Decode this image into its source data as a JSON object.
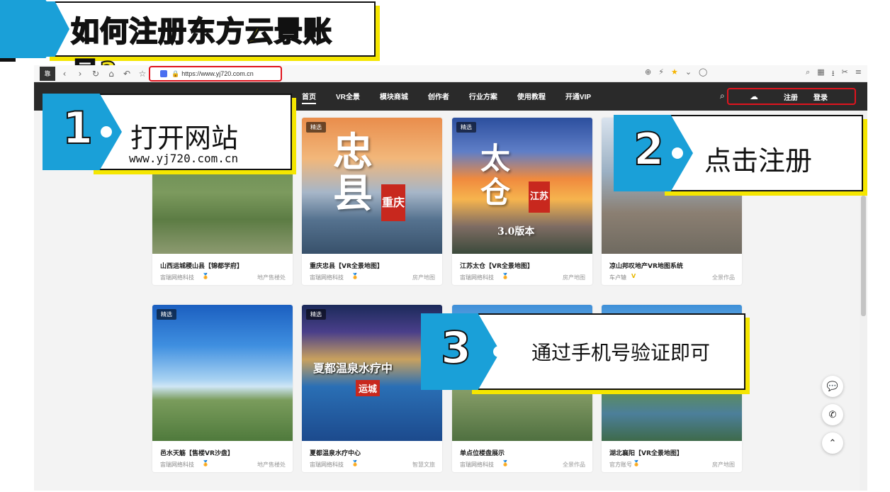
{
  "banner": {
    "title": "如何注册东方云景账号?"
  },
  "browser": {
    "url": "https://www.yj720.com.cn",
    "logo_text": "靠"
  },
  "site_nav": {
    "items": [
      "首页",
      "VR全景",
      "模块商城",
      "创作者",
      "行业方案",
      "使用教程",
      "开通VIP"
    ],
    "register": "注册",
    "login": "登录"
  },
  "cards": [
    {
      "tag": "",
      "title": "山西运城稷山县【锦都学府】",
      "author": "宙瑞网络科技",
      "category": "地产售楼处"
    },
    {
      "tag": "精选",
      "title": "重庆忠县【VR全景地图】",
      "author": "宙瑞网络科技",
      "category": "房产地图"
    },
    {
      "tag": "精选",
      "title": "江苏太仓【VR全景地图】",
      "author": "宙瑞网络科技",
      "category": "房产地图"
    },
    {
      "tag": "",
      "title": "凉山邦叹地产VR地图系统",
      "author": "车卢辕",
      "category": "全景作品"
    },
    {
      "tag": "精选",
      "title": "邑水天觞【售楼VR沙盘】",
      "author": "宙瑞网络科技",
      "category": "地产售楼处"
    },
    {
      "tag": "精选",
      "title": "夏都温泉水疗中心",
      "author": "宙瑞网络科技",
      "category": "智慧文旅"
    },
    {
      "tag": "",
      "title": "单点位楼盘展示",
      "author": "宙瑞网络科技",
      "category": "全景作品"
    },
    {
      "tag": "",
      "title": "湖北襄阳【VR全景地图】",
      "author": "官方账号",
      "category": "房产地图"
    }
  ],
  "thumb_text": {
    "zhong_big": "忠县",
    "zhong_seal": "重庆",
    "taicang_big": "太仓",
    "taicang_seal": "江苏",
    "taicang_version": "3.0版本",
    "pool_title": "夏都温泉水疗中",
    "pool_sub": "运城"
  },
  "steps": [
    {
      "num": "1",
      "text": "打开网站",
      "sub": "www.yj720.com.cn"
    },
    {
      "num": "2",
      "text": "点击注册",
      "sub": ""
    },
    {
      "num": "3",
      "text": "通过手机号验证即可",
      "sub": ""
    }
  ],
  "icons": {
    "badge_medal": "medal-icon",
    "badge_v": "V",
    "fab_wechat": "wechat-icon",
    "fab_phone": "phone-icon",
    "fab_top": "chevron-up-icon"
  },
  "colors": {
    "accent_blue": "#1aa0d8",
    "highlight_yellow": "#f5e600",
    "alert_red": "#e0141e",
    "nav_dark": "#2a2a2a"
  }
}
